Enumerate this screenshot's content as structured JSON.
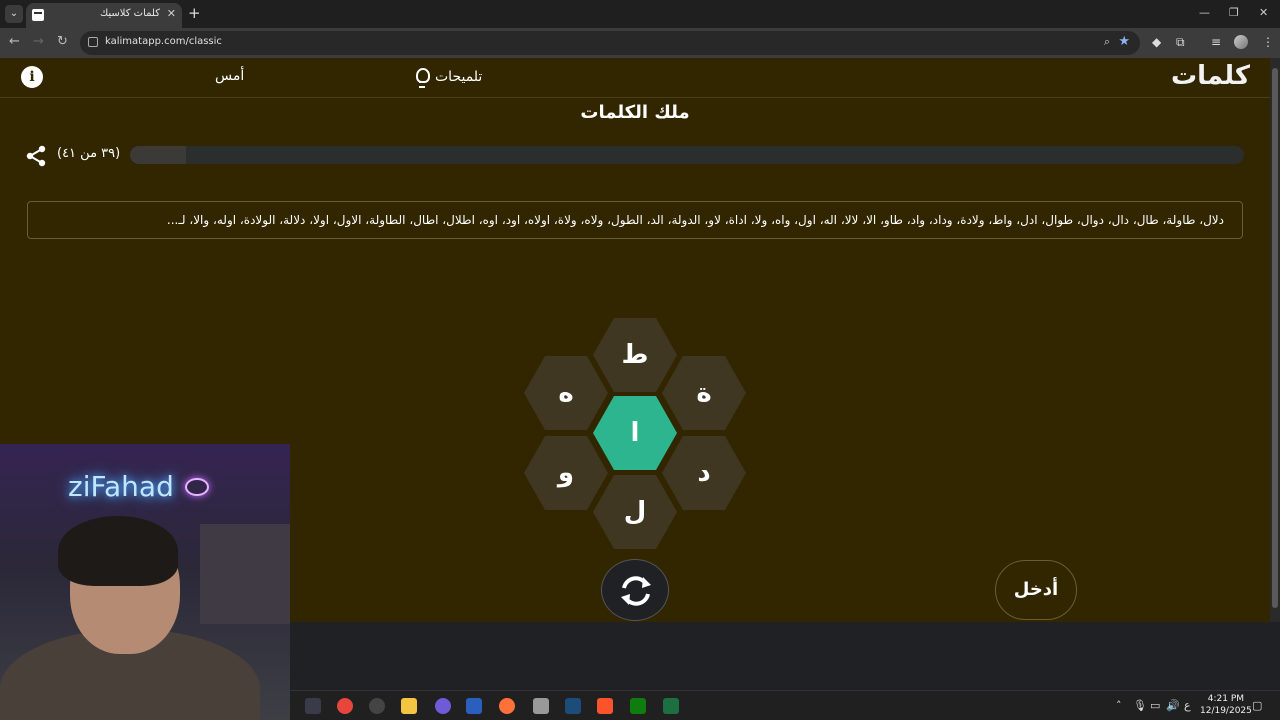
{
  "browser": {
    "tab_title": "كلمات كلاسيك",
    "url": "kalimatapp.com/classic"
  },
  "header": {
    "logo": "كلمات",
    "hints_label": "تلميحات",
    "yesterday_label": "أمس",
    "info_label": "i"
  },
  "rank": "ملك الكلمات",
  "progress": {
    "label": "(٣٩ من ٤١)",
    "found": 39,
    "total": 41,
    "fill_fraction": 0.05
  },
  "found_words": "دلال، طاولة، طال، دال، دوال، طوال، ادل، واط، ولادة، وداد، واد، طاو، الا، لالا، اله، اول، واه، ولا، اداة، لاو، الدولة، الد، الطول، ولاه، ولاة، اولاه، اود، اوه، اطلال، اطال، الطاولة، الاول، اولا، دلالة، الولادة، اوله، والا، لـ...",
  "letters": {
    "top": "ط",
    "upper_left": "ه",
    "upper_right": "ة",
    "center": "ا",
    "lower_left": "و",
    "lower_right": "د",
    "bottom": "ل"
  },
  "buttons": {
    "enter": "أدخل"
  },
  "webcam": {
    "neon_text": "ziFahad"
  },
  "taskbar": {
    "lang": "ع",
    "time": "4:21 PM",
    "date": "12/19/2025"
  },
  "colors": {
    "page_bg": "#322600",
    "center_hex": "#2cb58f",
    "outer_hex": "#3f3722"
  }
}
